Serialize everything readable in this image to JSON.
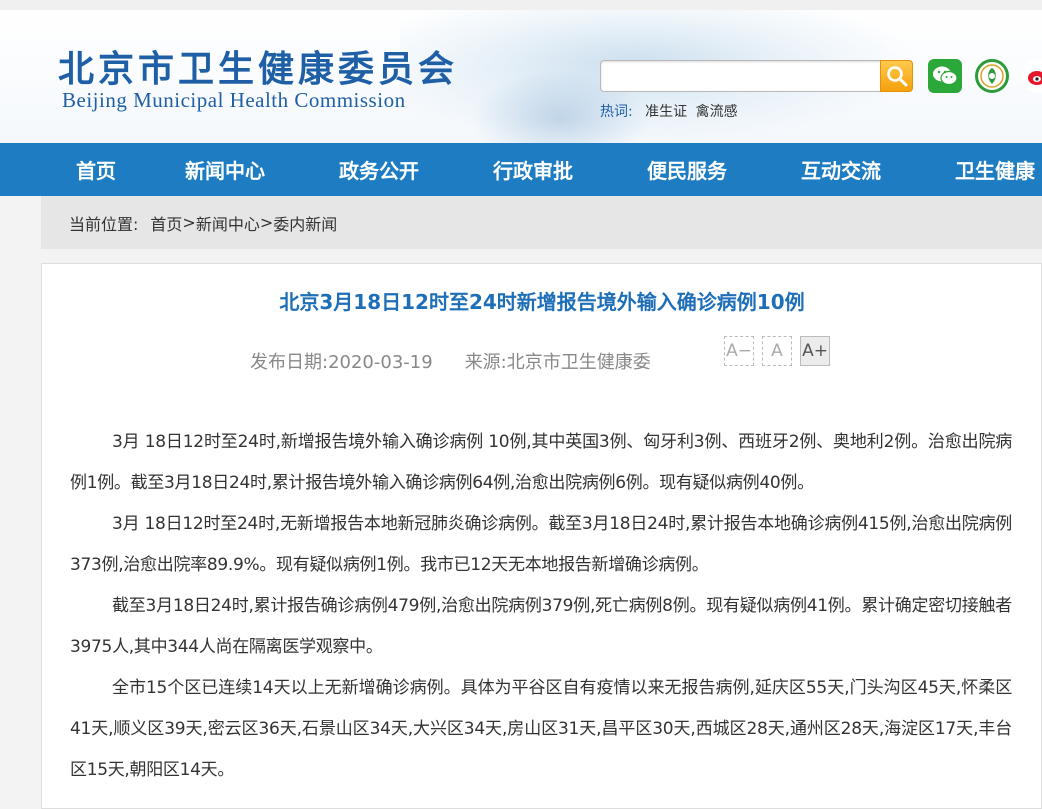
{
  "header": {
    "logo_cn": "北京市卫生健康委员会",
    "logo_en": "Beijing Municipal Health Commission",
    "search_placeholder": "",
    "hotwords_label": "热词:",
    "hotwords": [
      "准生证",
      "禽流感"
    ]
  },
  "nav": {
    "items": [
      "首页",
      "新闻中心",
      "政务公开",
      "行政审批",
      "便民服务",
      "互动交流",
      "卫生健康"
    ]
  },
  "breadcrumb": {
    "label": "当前位置:",
    "path": [
      "首页",
      "新闻中心",
      "委内新闻"
    ],
    "separator": ">"
  },
  "article": {
    "title": "北京3月18日12时至24时新增报告境外输入确诊病例10例",
    "date_label": "发布日期:",
    "date": "2020-03-19",
    "source_label": "来源:",
    "source": "北京市卫生健康委",
    "font_buttons": [
      "A−",
      "A",
      "A+"
    ],
    "paragraphs": [
      "3月 18日12时至24时,新增报告境外输入确诊病例 10例,其中英国3例、匈牙利3例、西班牙2例、奥地利2例。治愈出院病例1例。截至3月18日24时,累计报告境外输入确诊病例64例,治愈出院病例6例。现有疑似病例40例。",
      "3月 18日12时至24时,无新增报告本地新冠肺炎确诊病例。截至3月18日24时,累计报告本地确诊病例415例,治愈出院病例373例,治愈出院率89.9%。现有疑似病例1例。我市已12天无本地报告新增确诊病例。",
      "截至3月18日24时,累计报告确诊病例479例,治愈出院病例379例,死亡病例8例。现有疑似病例41例。累计确定密切接触者3975人,其中344人尚在隔离医学观察中。",
      "全市15个区已连续14天以上无新增确诊病例。具体为平谷区自有疫情以来无报告病例,延庆区55天,门头沟区45天,怀柔区41天,顺义区39天,密云区36天,石景山区34天,大兴区34天,房山区31天,昌平区30天,西城区28天,通州区28天,海淀区17天,丰台区15天,朝阳区14天。"
    ]
  },
  "colors": {
    "brand_blue": "#1f5fa6",
    "nav_blue": "#1e7dc2",
    "title_blue": "#1f6fb8",
    "search_orange": "#f5a10c"
  },
  "icons": [
    "search-icon",
    "wechat-icon",
    "health-emblem-icon",
    "weibo-icon"
  ]
}
